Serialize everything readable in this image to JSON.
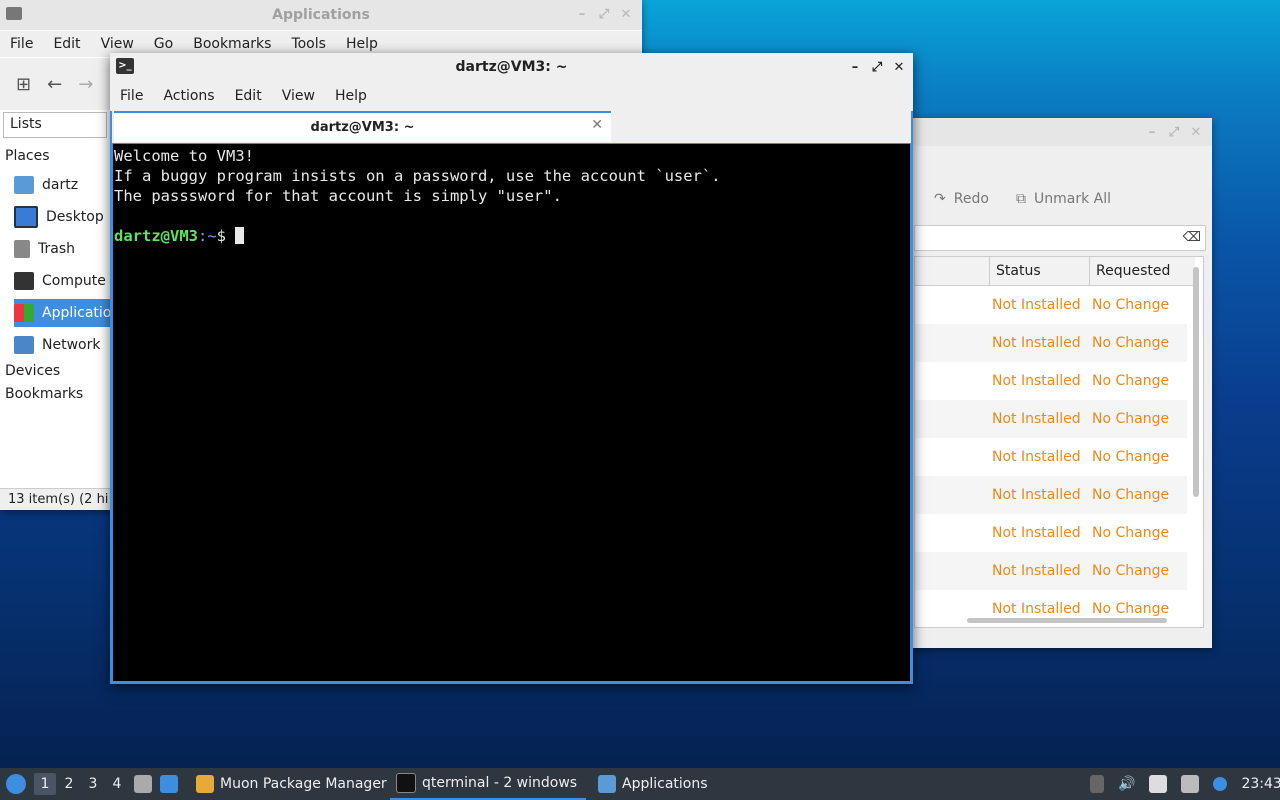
{
  "file_manager": {
    "title": "Applications",
    "menu": [
      "File",
      "Edit",
      "View",
      "Go",
      "Bookmarks",
      "Tools",
      "Help"
    ],
    "lists_label": "Lists",
    "places_label": "Places",
    "places": [
      {
        "label": "dartz",
        "icon": "home-folder-icon"
      },
      {
        "label": "Desktop",
        "icon": "desktop-icon"
      },
      {
        "label": "Trash",
        "icon": "trash-icon"
      },
      {
        "label": "Compute",
        "icon": "computer-icon"
      },
      {
        "label": "Applicatio",
        "icon": "applications-icon"
      },
      {
        "label": "Network",
        "icon": "network-icon"
      }
    ],
    "devices_label": "Devices",
    "bookmarks_label": "Bookmarks",
    "status": "13 item(s) (2 hi"
  },
  "muon": {
    "redo_label": "Redo",
    "unmark_all_label": "Unmark All",
    "columns": [
      "Status",
      "Requested"
    ],
    "rows": [
      {
        "status": "Not Installed",
        "requested": "No Change"
      },
      {
        "status": "Not Installed",
        "requested": "No Change"
      },
      {
        "status": "Not Installed",
        "requested": "No Change"
      },
      {
        "status": "Not Installed",
        "requested": "No Change"
      },
      {
        "status": "Not Installed",
        "requested": "No Change"
      },
      {
        "status": "Not Installed",
        "requested": "No Change"
      },
      {
        "status": "Not Installed",
        "requested": "No Change"
      },
      {
        "status": "Not Installed",
        "requested": "No Change"
      },
      {
        "status": "Not Installed",
        "requested": "No Change"
      }
    ]
  },
  "terminal": {
    "title": "dartz@VM3: ~",
    "menu": [
      "File",
      "Actions",
      "Edit",
      "View",
      "Help"
    ],
    "tab_title": "dartz@VM3: ~",
    "lines": [
      "Welcome to VM3!",
      "If a buggy program insists on a password, use the account `user`.",
      "The passsword for that account is simply \"user\"."
    ],
    "prompt_user": "dartz@VM3",
    "prompt_path": ":~",
    "prompt_symbol": "$"
  },
  "taskbar": {
    "workspaces": [
      "1",
      "2",
      "3",
      "4"
    ],
    "active_workspace": "1",
    "tasks": [
      {
        "label": "Muon Package Manager",
        "icon": "package-manager-icon"
      },
      {
        "label": "qterminal - 2 windows",
        "icon": "terminal-icon"
      },
      {
        "label": "Applications",
        "icon": "folder-icon"
      }
    ],
    "clock": "23:43"
  }
}
